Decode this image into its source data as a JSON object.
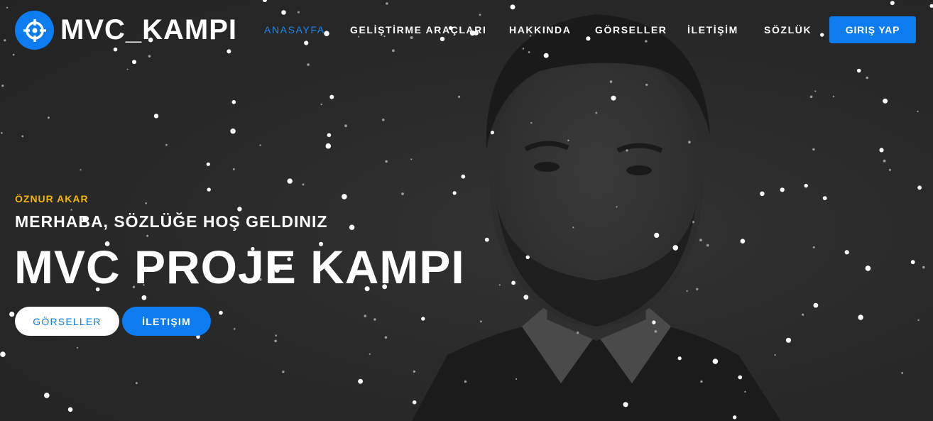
{
  "brand": {
    "name": "MVC_KAMPI",
    "icon": "crosshair-icon"
  },
  "nav": {
    "items": [
      {
        "label": "ANASAYFA",
        "active": true
      },
      {
        "label": "GELİŞTİRME ARAÇLARI",
        "active": false
      },
      {
        "label": "HAKKINDA",
        "active": false
      },
      {
        "label": "GÖRSELLER",
        "active": false
      },
      {
        "label": "İLETİŞİM",
        "active": false
      },
      {
        "label": "SÖZLÜK",
        "active": false
      }
    ],
    "login_label": "GIRIŞ YAP"
  },
  "hero": {
    "eyebrow": "ÖZNUR AKAR",
    "subtitle": "MERHABA, SÖZLÜĞE HOŞ GELDINIZ",
    "headline": "MVC PROJE KAMPI",
    "gallery_button": "GÖRSELLER",
    "contact_button": "İLETIŞIM"
  },
  "colors": {
    "accent": "#0d7cf0",
    "eyebrow": "#f2b705",
    "background": "#262626"
  }
}
